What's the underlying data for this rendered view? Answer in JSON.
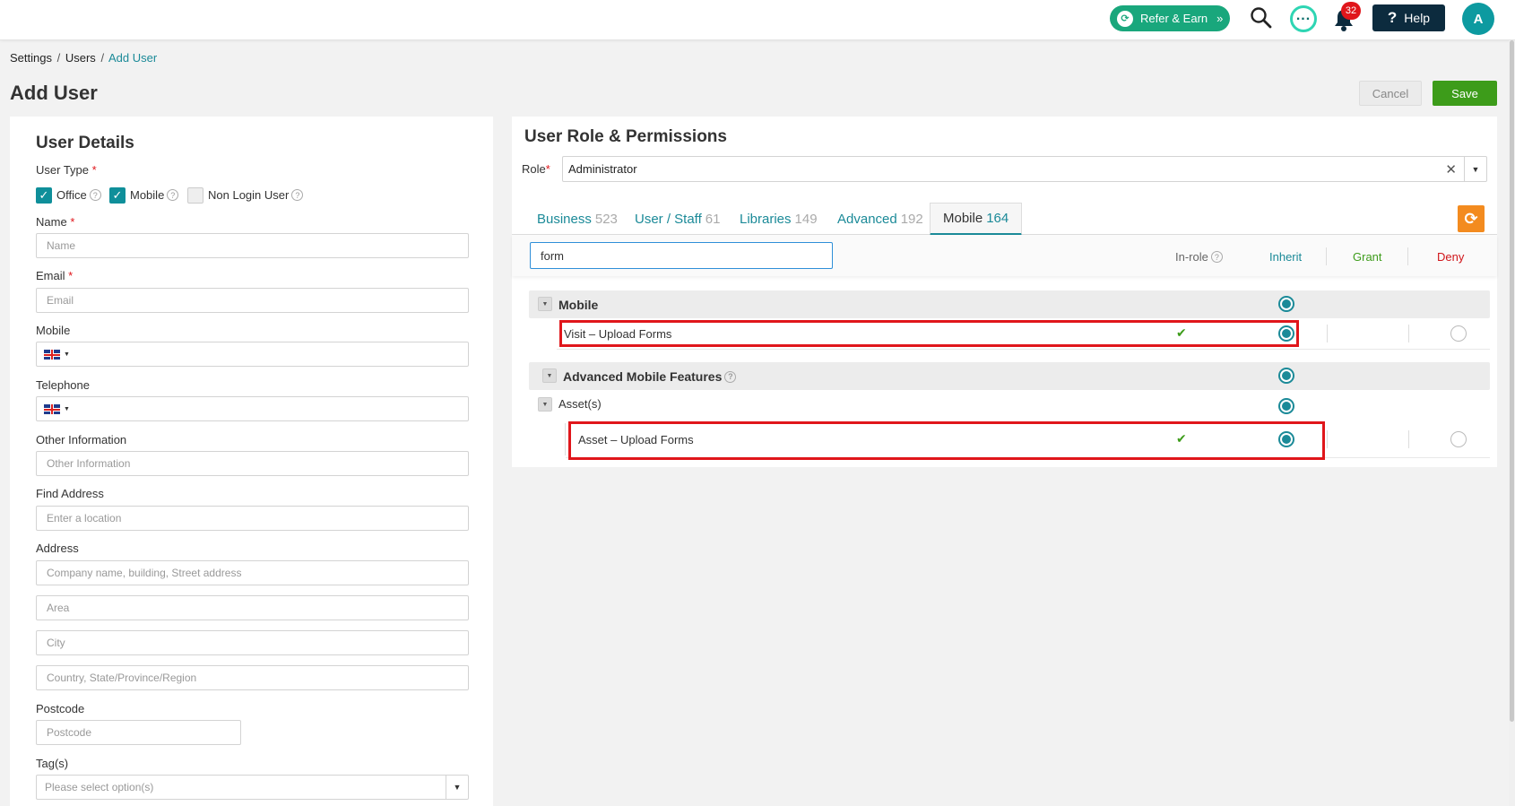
{
  "topbar": {
    "refer_label": "Refer & Earn",
    "notification_count": "32",
    "help_label": "Help",
    "avatar_initial": "A"
  },
  "breadcrumb": {
    "items": [
      "Settings",
      "Users",
      "Add User"
    ],
    "separator": "/"
  },
  "page": {
    "title": "Add User",
    "cancel_label": "Cancel",
    "save_label": "Save"
  },
  "user_details": {
    "title": "User Details",
    "user_type_label": "User Type",
    "user_types": [
      {
        "label": "Office",
        "checked": true
      },
      {
        "label": "Mobile",
        "checked": true
      },
      {
        "label": "Non Login User",
        "checked": false
      }
    ],
    "name_label": "Name",
    "name_placeholder": "Name",
    "email_label": "Email",
    "email_placeholder": "Email",
    "mobile_label": "Mobile",
    "telephone_label": "Telephone",
    "other_info_label": "Other Information",
    "other_info_placeholder": "Other Information",
    "find_address_label": "Find Address",
    "find_address_placeholder": "Enter a location",
    "address_label": "Address",
    "address_line_placeholder": "Company name, building, Street address",
    "area_placeholder": "Area",
    "city_placeholder": "City",
    "country_placeholder": "Country, State/Province/Region",
    "postcode_label": "Postcode",
    "postcode_placeholder": "Postcode",
    "tags_label": "Tag(s)",
    "tags_placeholder": "Please select option(s)",
    "required_mark": "*"
  },
  "permissions": {
    "title": "User Role & Permissions",
    "role_label": "Role",
    "role_value": "Administrator",
    "tabs": [
      {
        "label": "Business",
        "count": "523",
        "active": false
      },
      {
        "label": "User / Staff",
        "count": "61",
        "active": false
      },
      {
        "label": "Libraries",
        "count": "149",
        "active": false
      },
      {
        "label": "Advanced",
        "count": "192",
        "active": false
      },
      {
        "label": "Mobile",
        "count": "164",
        "active": true
      }
    ],
    "search_value": "form",
    "columns": {
      "inrole": "In-role",
      "inherit": "Inherit",
      "grant": "Grant",
      "deny": "Deny"
    },
    "column_colors": {
      "inherit": "#1b8a98",
      "grant": "#3d9c1a",
      "deny": "#d0161b"
    },
    "groups": [
      {
        "label": "Mobile",
        "items": [
          {
            "label": "Visit – Upload Forms",
            "in_role": true,
            "selected": "inherit"
          }
        ]
      },
      {
        "label": "Advanced Mobile Features",
        "subgroups": [
          {
            "label": "Asset(s)",
            "items": [
              {
                "label": "Asset – Upload Forms",
                "in_role": true,
                "selected": "inherit"
              }
            ]
          }
        ]
      }
    ]
  },
  "colors": {
    "accent": "#1b8a98",
    "save": "#3d9c1a",
    "refer": "#19a77c",
    "refresh": "#f38b1f",
    "highlight": "#e0161b"
  }
}
